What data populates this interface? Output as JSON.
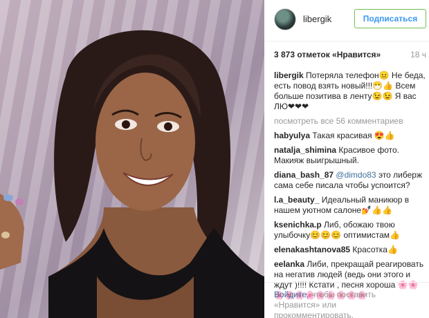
{
  "post": {
    "username": "libergik",
    "follow_label": "Подписаться",
    "likes": "3 873 отметок «Нравится»",
    "time": "18 ч"
  },
  "caption": {
    "author": "libergik",
    "text": "Потеряла телефон😐 Не беда, есть повод взять новый!!!😷👍 Всем больше позитива в ленту😉😉 Я вас ЛЮ❤❤❤"
  },
  "view_all": "посмотреть все 56 комментариев",
  "comments": [
    {
      "author": "habyulya",
      "text": "Такая красивая 😍👍"
    },
    {
      "author": "natalja_shimina",
      "text": "Красивое фото. Макияж выигрышный."
    },
    {
      "author": "diana_bash_87",
      "mention": "@dimdo83",
      "text": "это либерж сама себе писала чтобы успоится?"
    },
    {
      "author": "l.a_beauty_",
      "text": "Идеальный маникюр в нашем уютном салоне💅👍👍"
    },
    {
      "author": "ksenichka.p",
      "text": "Либ, обожаю твою улыбочку😊😊😊 оптимистам👍"
    },
    {
      "author": "elenakashtanova85",
      "text": "Красотка👍"
    },
    {
      "author": "eelanka",
      "text": "Либи, прекращай реагировать на негатив людей (ведь они этого и ждут )!!!! Кстати , песня хороша 🌸🌸🌸🌸🌸🌸🌸🌸🌸🌸🌸"
    }
  ],
  "footer": {
    "login_link": "Войдите,",
    "text_mid": "чтобы поставить «Нравится» или",
    "text_end": "прокомментировать."
  }
}
